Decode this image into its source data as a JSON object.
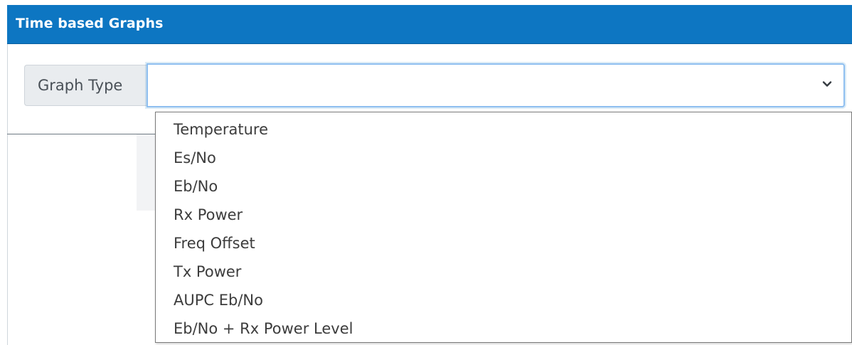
{
  "panel": {
    "title": "Time based Graphs",
    "header_color": "#0d76c2"
  },
  "graph_type": {
    "label": "Graph Type",
    "selected": "",
    "expand_icon": "chevron-down-icon",
    "options": [
      "Temperature",
      "Es/No",
      "Eb/No",
      "Rx Power",
      "Freq Offset",
      "Tx Power",
      "AUPC Eb/No",
      "Eb/No + Rx Power Level"
    ]
  }
}
